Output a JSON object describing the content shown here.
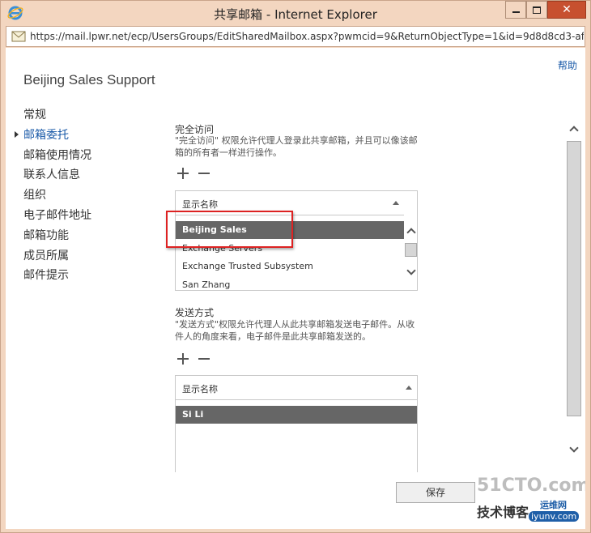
{
  "window": {
    "title": "共享邮箱 - Internet Explorer",
    "close_label": "✕"
  },
  "address": {
    "url": "https://mail.lpwr.net/ecp/UsersGroups/EditSharedMailbox.aspx?pwmcid=9&ReturnObjectType=1&id=9d8d8cd3-af"
  },
  "page": {
    "help": "帮助",
    "mailbox_name": "Beijing Sales Support"
  },
  "nav": {
    "items": [
      {
        "label": "常规"
      },
      {
        "label": "邮箱委托"
      },
      {
        "label": "邮箱使用情况"
      },
      {
        "label": "联系人信息"
      },
      {
        "label": "组织"
      },
      {
        "label": "电子邮件地址"
      },
      {
        "label": "邮箱功能"
      },
      {
        "label": "成员所属"
      },
      {
        "label": "邮件提示"
      }
    ],
    "active_index": 1
  },
  "full_access": {
    "title": "完全访问",
    "description": "\"完全访问\" 权限允许代理人登录此共享邮箱，并且可以像该邮箱的所有者一样进行操作。",
    "column_header": "显示名称",
    "rows": [
      {
        "name": "Beijing Sales",
        "selected": true
      },
      {
        "name": "Exchange Servers",
        "selected": false
      },
      {
        "name": "Exchange Trusted Subsystem",
        "selected": false
      },
      {
        "name": "San Zhang",
        "selected": false
      }
    ]
  },
  "send_as": {
    "title": "发送方式",
    "description": "\"发送方式\"权限允许代理人从此共享邮箱发送电子邮件。从收件人的角度来看，电子邮件是此共享邮箱发送的。",
    "column_header": "显示名称",
    "rows": [
      {
        "name": "Si Li",
        "selected": true
      }
    ]
  },
  "buttons": {
    "save": "保存"
  },
  "watermark": {
    "line1": "51CTO.com",
    "line2": "技术博客",
    "line3": "运维网",
    "line4": "iyunv.com"
  },
  "colors": {
    "accent": "#1a5aa8",
    "selected_row": "#666666",
    "highlight": "#dd2222"
  }
}
